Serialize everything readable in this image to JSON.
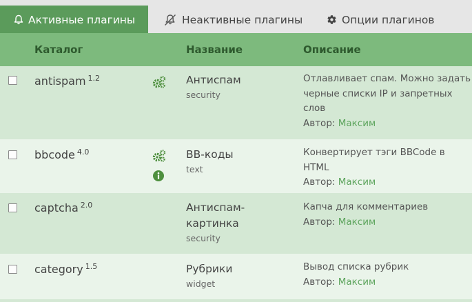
{
  "tabs": {
    "active": {
      "label": "Активные плагины",
      "icon": "bell-icon"
    },
    "inactive": {
      "label": "Неактивные плагины",
      "icon": "bell-slash-icon"
    },
    "options": {
      "label": "Опции плагинов",
      "icon": "gear-icon"
    }
  },
  "table": {
    "columns": {
      "catalog": "Каталог",
      "name": "Название",
      "description": "Описание"
    },
    "rows": [
      {
        "catalog": "antispam",
        "version": "1.2",
        "name": "Антиспам",
        "tag": "security",
        "description": "Отлавливает спам. Можно задать черные списки IP и запретных слов",
        "author_label": "Автор:",
        "author": "Максим"
      },
      {
        "catalog": "bbcode",
        "version": "4.0",
        "name": "BB-коды",
        "tag": "text",
        "description": "Конвертирует тэги BBCode в HTML",
        "author_label": "Автор:",
        "author": "Максим"
      },
      {
        "catalog": "captcha",
        "version": "2.0",
        "name": "Антиспам-картинка",
        "tag": "security",
        "description": "Капча для комментариев",
        "author_label": "Автор:",
        "author": "Максим"
      },
      {
        "catalog": "category",
        "version": "1.5",
        "name": "Рубрики",
        "tag": "widget",
        "description": "Вывод списка рубрик",
        "author_label": "Автор:",
        "author": "Максим"
      }
    ]
  },
  "colors": {
    "active_tab": "#5b9b5b",
    "header": "#7dba7d",
    "row_odd": "#d4e8d4",
    "row_even": "#eaf4ea",
    "link": "#5ea55e",
    "icon": "#4e8f3e"
  }
}
